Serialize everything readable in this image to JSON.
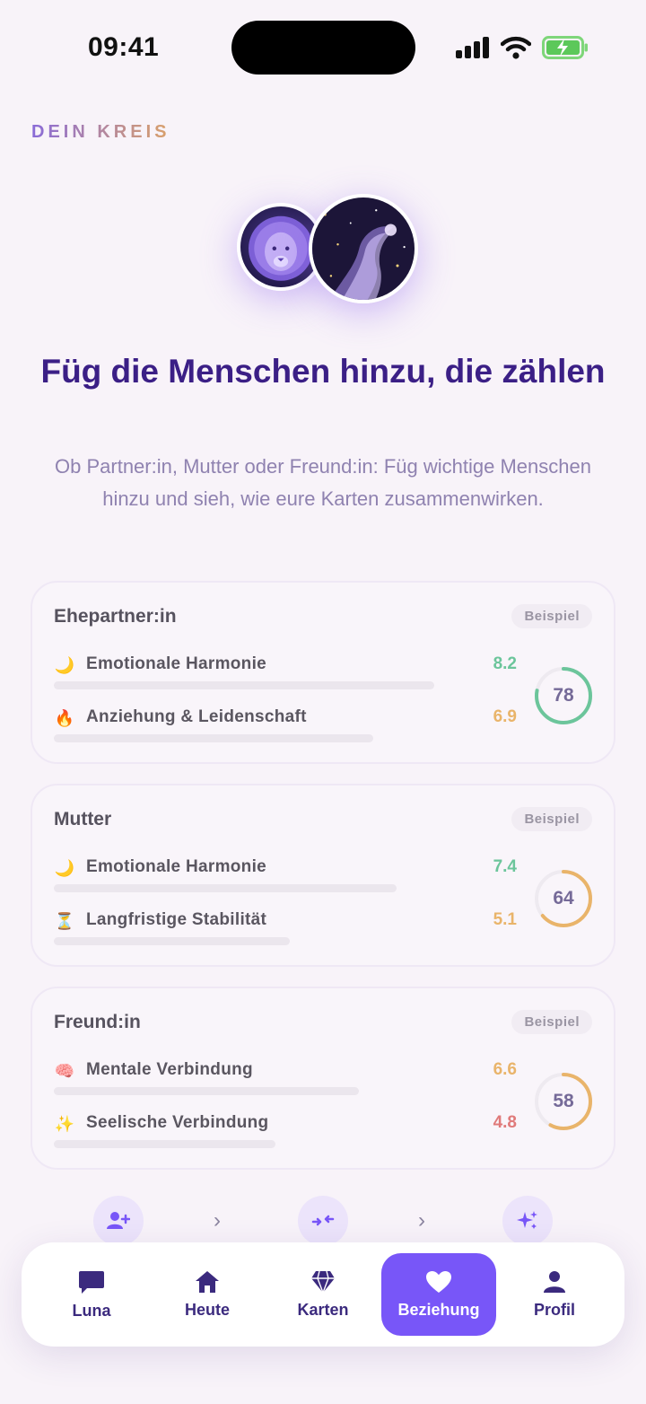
{
  "status": {
    "time": "09:41"
  },
  "section_label": "DEIN KREIS",
  "headline": "Füg die Menschen hinzu, die zählen",
  "subline": "Ob Partner:in, Mutter oder Freund:in: Füg wichtige Menschen hinzu und sieh, wie eure Karten zusammenwirken.",
  "cards": [
    {
      "title": "Ehepartner:in",
      "badge": "Beispiel",
      "score": "78",
      "score_color": "#6cc59b",
      "score_fraction": 0.78,
      "metrics": [
        {
          "emoji": "🌙",
          "label": "Emotionale Harmonie",
          "value": "8.2",
          "color": "#6cc59b"
        },
        {
          "emoji": "🔥",
          "label": "Anziehung & Leidenschaft",
          "value": "6.9",
          "color": "#e9b46a"
        }
      ]
    },
    {
      "title": "Mutter",
      "badge": "Beispiel",
      "score": "64",
      "score_color": "#e9b46a",
      "score_fraction": 0.64,
      "metrics": [
        {
          "emoji": "🌙",
          "label": "Emotionale Harmonie",
          "value": "7.4",
          "color": "#6cc59b"
        },
        {
          "emoji": "⏳",
          "label": "Langfristige Stabilität",
          "value": "5.1",
          "color": "#e9b46a"
        }
      ]
    },
    {
      "title": "Freund:in",
      "badge": "Beispiel",
      "score": "58",
      "score_color": "#e9b46a",
      "score_fraction": 0.58,
      "metrics": [
        {
          "emoji": "🧠",
          "label": "Mentale Verbindung",
          "value": "6.6",
          "color": "#e9b46a"
        },
        {
          "emoji": "✨",
          "label": "Seelische Verbindung",
          "value": "4.8",
          "color": "#e07a7a"
        }
      ]
    }
  ],
  "steps": [
    {
      "icon": "add-user-icon"
    },
    {
      "icon": "merge-icon"
    },
    {
      "icon": "sparkles-icon"
    }
  ],
  "tabs": [
    {
      "label": "Luna",
      "icon": "chat-icon",
      "active": false
    },
    {
      "label": "Heute",
      "icon": "home-icon",
      "active": false
    },
    {
      "label": "Karten",
      "icon": "gem-icon",
      "active": false
    },
    {
      "label": "Beziehung",
      "icon": "heart-icon",
      "active": true
    },
    {
      "label": "Profil",
      "icon": "person-icon",
      "active": false
    }
  ],
  "colors": {
    "accent": "#7856f8",
    "heading": "#3b1f86",
    "background": "#f8f3f9"
  }
}
